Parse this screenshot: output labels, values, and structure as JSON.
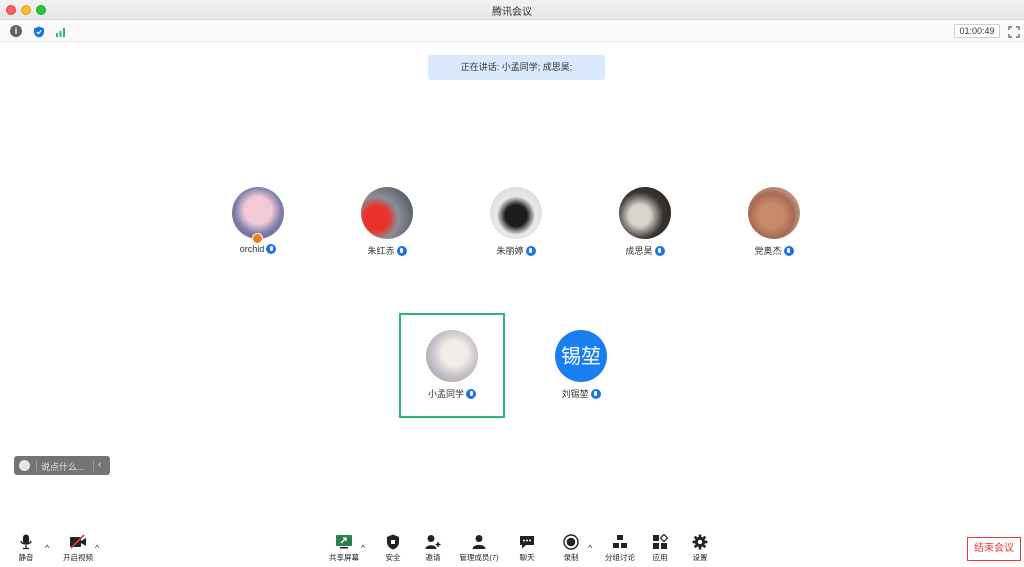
{
  "window": {
    "title": "腾讯会议"
  },
  "toolbar": {
    "timer": "01:00:49"
  },
  "speaking": {
    "text": "正在讲话: 小孟同学; 成思昊;"
  },
  "participants": [
    {
      "name": "orchid",
      "host": true
    },
    {
      "name": "朱红赤"
    },
    {
      "name": "朱丽婷"
    },
    {
      "name": "成思昊"
    },
    {
      "name": "党奥杰"
    },
    {
      "name": "小孟同学",
      "speaking_highlight": true
    },
    {
      "name": "刘锡堃",
      "avatar_text": "锡堃"
    }
  ],
  "chat": {
    "placeholder": "说点什么..."
  },
  "bottom": {
    "mute": "静音",
    "video": "开启视频",
    "share": "共享屏幕",
    "security": "安全",
    "invite": "邀请",
    "members": "管理成员(7)",
    "chat": "聊天",
    "record": "录制",
    "breakout": "分组讨论",
    "apps": "应用",
    "settings": "设置",
    "end": "结束会议"
  },
  "colors": {
    "accent": "#1a73e8",
    "speaker_border": "#2bb673",
    "end": "#e23b3b"
  }
}
